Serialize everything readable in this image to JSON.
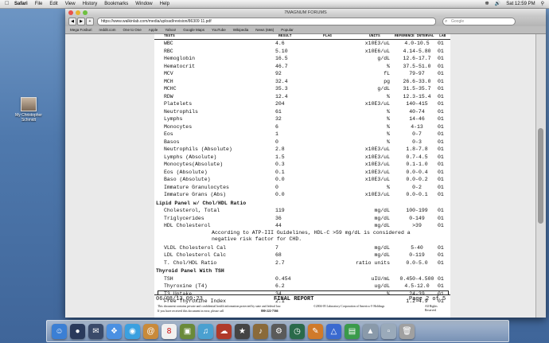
{
  "menubar": {
    "app": "Safari",
    "menus": [
      "Safari",
      "File",
      "Edit",
      "View",
      "History",
      "Bookmarks",
      "Window",
      "Help"
    ],
    "clock": "Sat 12:59 PM"
  },
  "desktop": {
    "icon_label": "My Christopher Schmidt"
  },
  "window": {
    "title": "7MAGNUM FORUMS",
    "subtitle": "https://www.walkinlab.com/media/upload/revision/86309 11.pdf",
    "url": "https://www.walkinlab.com/media/upload/revision/86309 11.pdf",
    "search_placeholder": "Google",
    "bookmarks": [
      "Mega Fosburi",
      "reddit.com",
      "One to One",
      "Apple",
      "Yahoo!",
      "Google Maps",
      "YouTube",
      "Wikipedia",
      "News (666)",
      "Popular"
    ]
  },
  "report": {
    "headers": {
      "test": "TESTS",
      "result": "RESULT",
      "flag": "FLAG",
      "units": "UNITS",
      "ref": "REFERENCE INTERVAL",
      "lab": "LAB"
    },
    "rows_cbc": [
      {
        "test": "WBC",
        "result": "4.6",
        "units": "x10E3/uL",
        "ref": "4.0-10.5",
        "lab": "01"
      },
      {
        "test": "RBC",
        "result": "5.10",
        "units": "x10E6/uL",
        "ref": "4.14-5.80",
        "lab": "01"
      },
      {
        "test": "Hemoglobin",
        "result": "16.5",
        "units": "g/dL",
        "ref": "12.6-17.7",
        "lab": "01"
      },
      {
        "test": "Hematocrit",
        "result": "46.7",
        "units": "%",
        "ref": "37.5-51.0",
        "lab": "01"
      },
      {
        "test": "MCV",
        "result": "92",
        "units": "fL",
        "ref": "79-97",
        "lab": "01"
      },
      {
        "test": "MCH",
        "result": "32.4",
        "units": "pg",
        "ref": "26.6-33.0",
        "lab": "01"
      },
      {
        "test": "MCHC",
        "result": "35.3",
        "units": "g/dL",
        "ref": "31.5-35.7",
        "lab": "01"
      },
      {
        "test": "RDW",
        "result": "12.4",
        "units": "%",
        "ref": "12.3-15.4",
        "lab": "01"
      },
      {
        "test": "Platelets",
        "result": "204",
        "units": "x10E3/uL",
        "ref": "140-415",
        "lab": "01"
      },
      {
        "test": "Neutrophils",
        "result": "61",
        "units": "%",
        "ref": "40-74",
        "lab": "01"
      },
      {
        "test": "Lymphs",
        "result": "32",
        "units": "%",
        "ref": "14-46",
        "lab": "01"
      },
      {
        "test": "Monocytes",
        "result": "6",
        "units": "%",
        "ref": "4-13",
        "lab": "01"
      },
      {
        "test": "Eos",
        "result": "1",
        "units": "%",
        "ref": "0-7",
        "lab": "01"
      },
      {
        "test": "Basos",
        "result": "0",
        "units": "%",
        "ref": "0-3",
        "lab": "01"
      },
      {
        "test": "Neutrophils (Absolute)",
        "result": "2.8",
        "units": "x10E3/uL",
        "ref": "1.8-7.8",
        "lab": "01"
      },
      {
        "test": "Lymphs (Absolute)",
        "result": "1.5",
        "units": "x10E3/uL",
        "ref": "0.7-4.5",
        "lab": "01"
      },
      {
        "test": "Monocytes(Absolute)",
        "result": "0.3",
        "units": "x10E3/uL",
        "ref": "0.1-1.0",
        "lab": "01"
      },
      {
        "test": "Eos (Absolute)",
        "result": "0.1",
        "units": "x10E3/uL",
        "ref": "0.0-0.4",
        "lab": "01"
      },
      {
        "test": "Baso (Absolute)",
        "result": "0.0",
        "units": "x10E3/uL",
        "ref": "0.0-0.2",
        "lab": "01"
      },
      {
        "test": "Immature Granulocytes",
        "result": "0",
        "units": "%",
        "ref": "0-2",
        "lab": "01"
      },
      {
        "test": "Immature Grans (Abs)",
        "result": "0.0",
        "units": "x10E3/uL",
        "ref": "0.0-0.1",
        "lab": "01"
      }
    ],
    "lipid_title": "Lipid Panel w/ Chol/HDL Ratio",
    "rows_lipid1": [
      {
        "test": "Cholesterol, Total",
        "result": "119",
        "units": "mg/dL",
        "ref": "100-199",
        "lab": "01"
      },
      {
        "test": "Triglycerides",
        "result": "36",
        "units": "mg/dL",
        "ref": "0-149",
        "lab": "01"
      },
      {
        "test": "HDL Cholesterol",
        "result": "44",
        "units": "mg/dL",
        "ref": ">39",
        "lab": "01"
      }
    ],
    "note1": "According to ATP-III Guidelines, HDL-C >59 mg/dL is considered a",
    "note2": "negative risk factor for CHD.",
    "rows_lipid2": [
      {
        "test": "VLDL Cholesterol Cal",
        "result": "7",
        "units": "mg/dL",
        "ref": "5-40",
        "lab": "01"
      },
      {
        "test": "LDL Cholesterol Calc",
        "result": "68",
        "units": "mg/dL",
        "ref": "0-119",
        "lab": "01"
      },
      {
        "test": "T. Chol/HDL Ratio",
        "result": "2.7",
        "units": "ratio units",
        "ref": "0.0-5.0",
        "lab": "01"
      }
    ],
    "thyroid_title": "Thyroid Panel With TSH",
    "rows_thyroid": [
      {
        "test": "TSH",
        "result": "0.454",
        "units": "uIU/mL",
        "ref": "0.450-4.500",
        "lab": "01"
      },
      {
        "test": "Thyroxine (T4)",
        "result": "6.2",
        "units": "ug/dL",
        "ref": "4.5-12.0",
        "lab": "01"
      },
      {
        "test": "T3 Uptake",
        "result": "34",
        "units": "%",
        "ref": "24-39",
        "lab": "01"
      },
      {
        "test": "Free Thyroxine Index",
        "result": "2.1",
        "units": "",
        "ref": "1.2-4.9",
        "lab": "01"
      }
    ],
    "footer": {
      "datetime": "06/08/13 09:23",
      "status": "FINAL REPORT",
      "page": "Page 2 of 5",
      "small1": "This document contains private and confidential health information protected by state and federal law.",
      "small1b": "©2004-05 Laboratory Corporation of America ® Holdings",
      "small1c": "All Rights Reserved",
      "small2": "If you have received this document in error, please call",
      "phone": "800-222-7566"
    }
  }
}
